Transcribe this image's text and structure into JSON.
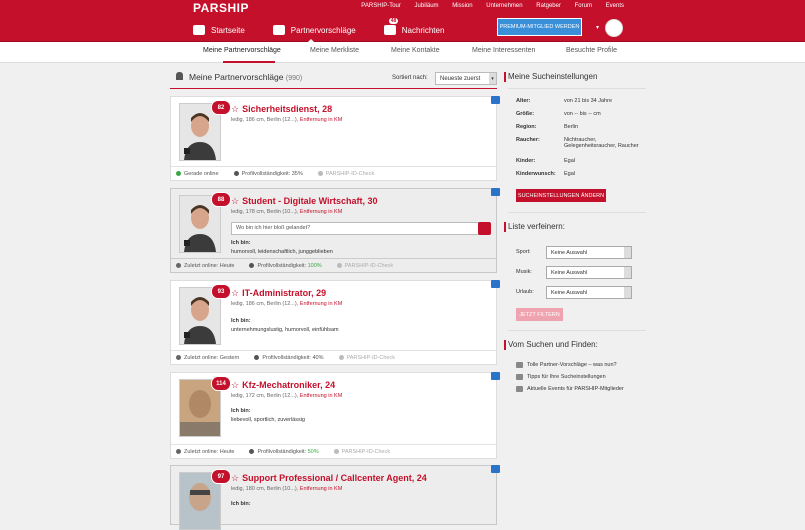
{
  "brand": "PARSHIP",
  "toplinks": [
    "PARSHIP-Tour",
    "Jubiläum",
    "Mission",
    "Unternehmen",
    "Ratgeber",
    "Forum",
    "Events"
  ],
  "mainnav": {
    "home": "Startseite",
    "proposals": "Partnervorschläge",
    "messages": "Nachrichten",
    "messages_count": "48"
  },
  "premium_button": "PREMIUM-MITGLIED WERDEN",
  "subnav": [
    "Meine Partnervorschläge",
    "Meine Merkliste",
    "Meine Kontakte",
    "Meine Interessenten",
    "Besuchte Profile"
  ],
  "list": {
    "title": "Meine Partnervorschläge",
    "count": "(990)",
    "sort_label": "Sortiert nach:",
    "sort_value": "Neueste zuerst"
  },
  "cards": [
    {
      "match": "82",
      "name": "Sicherheitsdienst, 28",
      "meta": "ledig, 186 cm, Berlin (12...),",
      "dist": "Entfernung in KM",
      "status": "Gerade online",
      "status_color": "#3aa645",
      "completeness": "Profilvollständigkeit: 35%",
      "idcheck": "PARSHIP-ID-Check"
    },
    {
      "match": "88",
      "name": "Student - Digitale Wirtschaft, 30",
      "meta": "ledig, 178 cm, Berlin (10...),",
      "dist": "Entfernung in KM",
      "message": "Wo bin ich hier bloß gelandet?",
      "ichbin_label": "Ich bin:",
      "ichbin": "humorvoll, leidenschaftlich, junggeblieben",
      "status": "Zuletzt online: Heute",
      "completeness_label": "Profilvollständigkeit:",
      "completeness_value": "100%",
      "idcheck": "PARSHIP-ID-Check"
    },
    {
      "match": "93",
      "name": "IT-Administrator, 29",
      "meta": "ledig, 186 cm, Berlin (12...),",
      "dist": "Entfernung in KM",
      "ichbin_label": "Ich bin:",
      "ichbin": "unternehmungslustig, humorvoll, einfühlsam",
      "status": "Zuletzt online: Gestern",
      "completeness": "Profilvollständigkeit: 40%",
      "idcheck": "PARSHIP-ID-Check"
    },
    {
      "match": "114",
      "name": "Kfz-Mechatroniker, 24",
      "meta": "ledig, 172 cm, Berlin (12...),",
      "dist": "Entfernung in KM",
      "ichbin_label": "Ich bin:",
      "ichbin": "liebevoll, sportlich, zuverlässig",
      "status": "Zuletzt online: Heute",
      "completeness_label": "Profilvollständigkeit:",
      "completeness_value": "50%",
      "idcheck": "PARSHIP-ID-Check"
    },
    {
      "match": "97",
      "name": "Support Professional / Callcenter Agent, 24",
      "meta": "ledig, 180 cm, Berlin (10...),",
      "dist": "Entfernung in KM",
      "ichbin_label": "Ich bin:"
    }
  ],
  "search": {
    "title": "Meine Sucheinstellungen",
    "rows": [
      {
        "k": "Alter:",
        "v": "von 21 bis 34 Jahre"
      },
      {
        "k": "Größe:",
        "v": "von -- bis -- cm"
      },
      {
        "k": "Region:",
        "v": "Berlin"
      },
      {
        "k": "Raucher:",
        "v": "Nichtraucher, Gelegenheitsraucher, Raucher"
      },
      {
        "k": "Kinder:",
        "v": "Egal"
      },
      {
        "k": "Kinderwunsch:",
        "v": "Egal"
      }
    ],
    "button": "SUCHEINSTELLUNGEN ÄNDERN"
  },
  "refine": {
    "title": "Liste verfeinern:",
    "filters": [
      {
        "k": "Sport:",
        "v": "Keine Auswahl"
      },
      {
        "k": "Musik:",
        "v": "Keine Auswahl"
      },
      {
        "k": "Urlaub:",
        "v": "Keine Auswahl"
      }
    ],
    "button": "JETZT FILTERN"
  },
  "find": {
    "title": "Vom Suchen und Finden:",
    "links": [
      "Tolle Partner-Vorschläge – was nun?",
      "Tipps für Ihre Sucheinstellungen",
      "Aktuelle Events für PARSHIP-Mitglieder"
    ]
  },
  "colors": {
    "brand_red": "#c4102b",
    "premium_blue": "#3a8fd9",
    "online_green": "#3aa645"
  }
}
